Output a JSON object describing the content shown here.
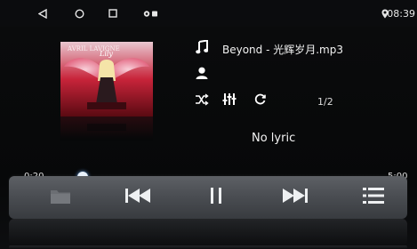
{
  "status_bar": {
    "time": "08:39",
    "icons": [
      "back-triangle-icon",
      "home-circle-icon",
      "recents-square-icon",
      "notification-icon",
      "location-pin-icon"
    ]
  },
  "track": {
    "title": "Beyond - 光辉岁月.mp3",
    "artist": "",
    "count": "1/2",
    "lyric": "No lyric"
  },
  "progress": {
    "elapsed": "0:20",
    "duration": "5:00",
    "position_fraction": 0.067
  },
  "controls": {
    "small": [
      "shuffle-icon",
      "equalizer-icon",
      "repeat-icon"
    ],
    "bottom": [
      "folder-icon",
      "previous-icon",
      "pause-icon",
      "next-icon",
      "playlist-icon"
    ]
  },
  "colors": {
    "accent": "#2e7bd8",
    "background": "#050607",
    "bottom_bar": "#4b4e53"
  }
}
